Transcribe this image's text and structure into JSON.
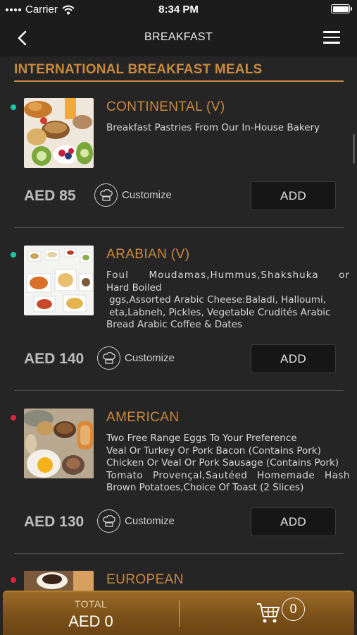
{
  "status_bar": {
    "carrier": "Carrier",
    "time": "8:34 PM"
  },
  "nav": {
    "title": "BREAKFAST"
  },
  "section": {
    "title": "INTERNATIONAL BREAKFAST MEALS"
  },
  "customize_label": "Customize",
  "add_label": "ADD",
  "items": [
    {
      "name": "CONTINENTAL (V)",
      "type": "veg",
      "desc_lines": [
        "Breakfast Pastries From Our In-House Bakery"
      ],
      "price": "AED 85"
    },
    {
      "name": "ARABIAN (V)",
      "type": "veg",
      "desc_lines": [
        "Foul Moudamas,Hummus,Shakshuka or",
        "Hard Boiled",
        "ggs,Assorted Arabic Cheese:Baladi, Halloumi,",
        "eta,Labneh, Pickles, Vegetable Crudités Arabic",
        "Bread Arabic Coffee & Dates"
      ],
      "price": "AED 140"
    },
    {
      "name": "AMERICAN",
      "type": "nonveg",
      "desc_lines": [
        "Two Free Range Eggs To Your Preference",
        "Veal Or Turkey Or Pork Bacon (Contains Pork)",
        "Chicken Or Veal Or Pork Sausage (Contains Pork)",
        "Tomato Provençal,Sautéed Homemade Hash",
        "Brown Potatoes,Choice Of Toast (2 Slices)"
      ],
      "price": "AED 130"
    },
    {
      "name": "EUROPEAN",
      "type": "nonveg",
      "desc_lines": [],
      "price": ""
    }
  ],
  "footer": {
    "total_label": "TOTAL",
    "total_value": "AED 0",
    "cart_count": "0"
  },
  "colors": {
    "accent": "#c9893e",
    "veg": "#19c6a7",
    "nonveg": "#e0233a",
    "background": "#252525"
  }
}
